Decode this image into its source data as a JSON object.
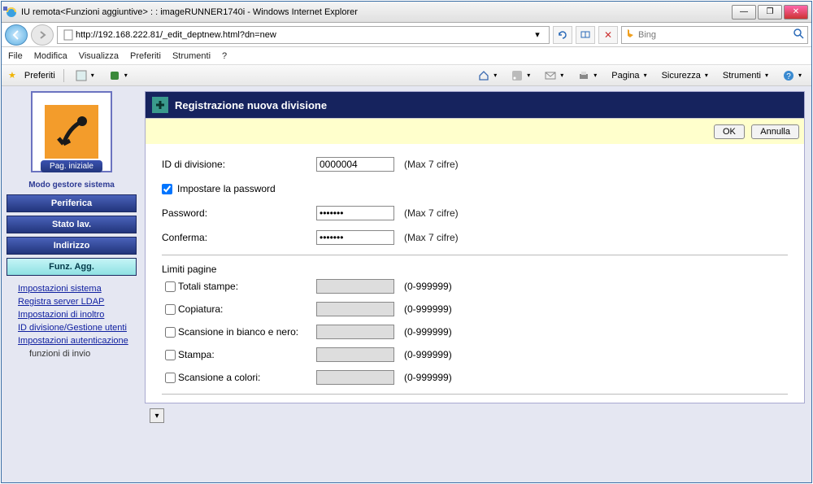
{
  "titlebar": "IU remota<Funzioni aggiuntive> : : imageRUNNER1740i - Windows Internet Explorer",
  "url": "http://192.168.222.81/_edit_deptnew.html?dn=new",
  "search_placeholder": "Bing",
  "menu": {
    "file": "File",
    "modifica": "Modifica",
    "visualizza": "Visualizza",
    "preferiti": "Preferiti",
    "strumenti": "Strumenti",
    "help": "?"
  },
  "favbar": {
    "preferiti": "Preferiti",
    "pagina": "Pagina",
    "sicurezza": "Sicurezza",
    "strumenti": "Strumenti"
  },
  "sidebar": {
    "home_label": "Pag. iniziale",
    "modo": "Modo gestore sistema",
    "nav": {
      "periferica": "Periferica",
      "stato": "Stato lav.",
      "indirizzo": "Indirizzo",
      "funz": "Funz. Agg."
    },
    "items": {
      "imp_sistema": "Impostazioni sistema",
      "reg_server": "Registra server LDAP",
      "imp_inoltro": "Impostazioni di inoltro",
      "id": "ID divisione/Gestione utenti",
      "imp_autenticazione": "Impostazioni autenticazione",
      "funzioni_invio": "funzioni di invio"
    }
  },
  "panel": {
    "title": "Registrazione nuova divisione",
    "ok": "OK",
    "annulla": "Annulla"
  },
  "form": {
    "id_label": "ID di divisione:",
    "id_value": "0000004",
    "cifre_hint": "(Max 7 cifre)",
    "impostare_pw": "Impostare la password",
    "password_label": "Password:",
    "password_value": "•••••••",
    "conferma_label": "Conferma:",
    "conferma_value": "•••••••",
    "limiti": "Limiti pagine",
    "range_hint": "(0-999999)",
    "rows": {
      "totali": "Totali stampe:",
      "copiatura": "Copiatura:",
      "scan_bn": "Scansione in bianco e nero:",
      "stampa": "Stampa:",
      "scan_col": "Scansione a colori:"
    }
  }
}
